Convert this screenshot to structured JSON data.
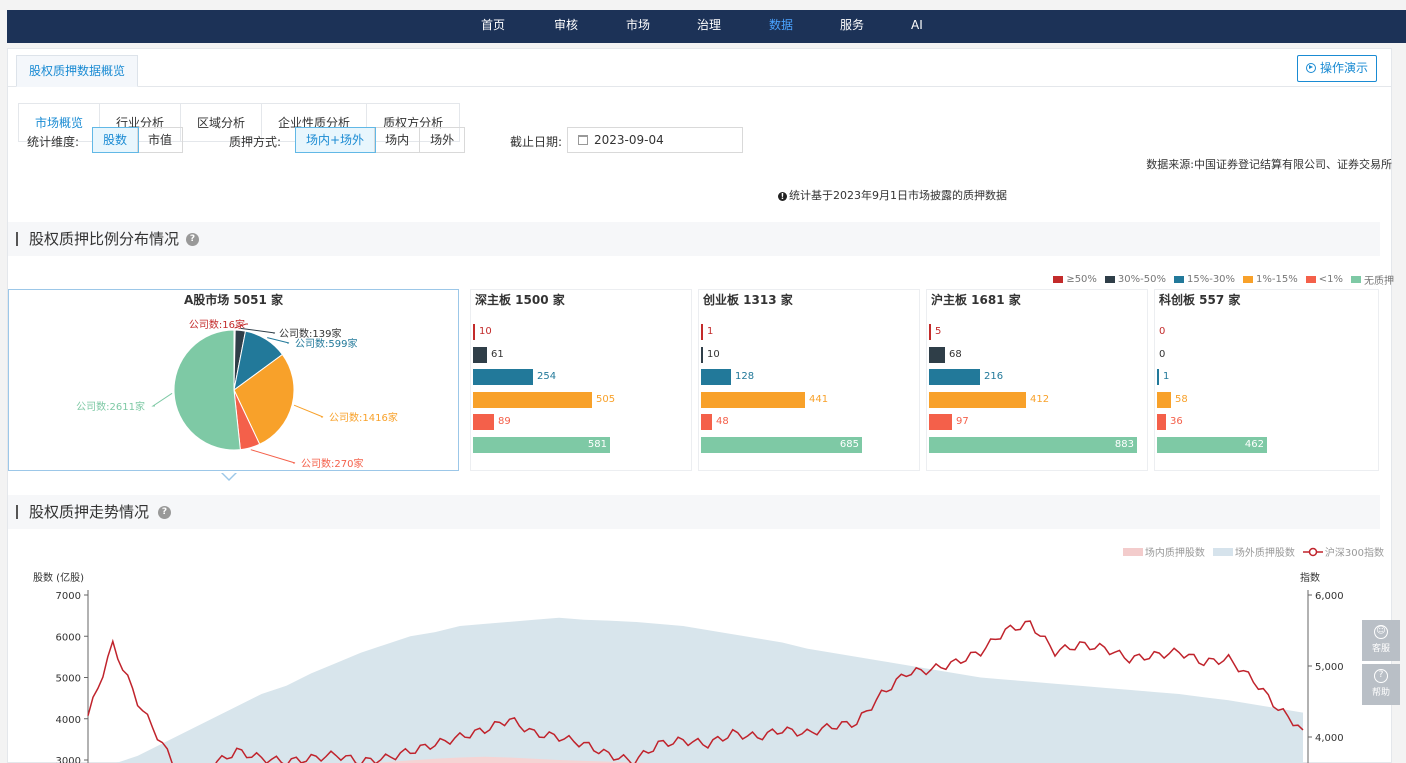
{
  "nav": {
    "items": [
      {
        "label": "首页",
        "active": false
      },
      {
        "label": "审核",
        "active": false
      },
      {
        "label": "市场",
        "active": false
      },
      {
        "label": "治理",
        "active": false
      },
      {
        "label": "数据",
        "active": true
      },
      {
        "label": "服务",
        "active": false
      },
      {
        "label": "AI",
        "active": false
      }
    ]
  },
  "page": {
    "main_tab": "股权质押数据概览",
    "demo_button": "操作演示",
    "subtabs": [
      "市场概览",
      "行业分析",
      "区域分析",
      "企业性质分析",
      "质权方分析"
    ],
    "active_subtab": "市场概览"
  },
  "filters": {
    "dimension_label": "统计维度:",
    "dimension_options": [
      "股数",
      "市值"
    ],
    "dimension_selected": "股数",
    "method_label": "质押方式:",
    "method_options": [
      "场内+场外",
      "场内",
      "场外"
    ],
    "method_selected": "场内+场外",
    "date_label": "截止日期:",
    "date_value": "2023-09-04",
    "note": "统计基于2023年9月1日市场披露的质押数据",
    "source": "数据来源:中国证券登记结算有限公司、证券交易所"
  },
  "section1": {
    "title": "股权质押比例分布情况"
  },
  "section2": {
    "title": "股权质押走势情况"
  },
  "colors": {
    "ge50": "#c32b2b",
    "p30_50": "#2f3e48",
    "p15_30": "#22799a",
    "p1_15": "#f8a12a",
    "lt1": "#f4604a",
    "none": "#7ec9a5",
    "nav_bg": "#1c3257",
    "accent": "#1a8bd3"
  },
  "chart_data": [
    {
      "type": "pie",
      "title": "A股市场 5051 家",
      "legend": [
        "≥50%",
        "30%-50%",
        "15%-30%",
        "1%-15%",
        "<1%",
        "无质押"
      ],
      "legend_position": "top-right",
      "labels": [
        "公司数:16家",
        "公司数:139家",
        "公司数:599家",
        "公司数:1416家",
        "公司数:270家",
        "公司数:2611家"
      ],
      "values": [
        16,
        139,
        599,
        1416,
        270,
        2611
      ]
    },
    {
      "type": "bar",
      "orientation": "horizontal",
      "boards": [
        {
          "title": "深主板 1500 家",
          "values": [
            10,
            61,
            254,
            505,
            89,
            581
          ]
        },
        {
          "title": "创业板 1313 家",
          "values": [
            1,
            10,
            128,
            441,
            48,
            685
          ]
        },
        {
          "title": "沪主板 1681 家",
          "values": [
            5,
            68,
            216,
            412,
            97,
            883
          ]
        },
        {
          "title": "科创板 557 家",
          "values": [
            0,
            0,
            1,
            58,
            36,
            462
          ]
        }
      ],
      "categories": [
        "≥50%",
        "30%-50%",
        "15%-30%",
        "1%-15%",
        "<1%",
        "无质押"
      ]
    },
    {
      "type": "area",
      "legend": [
        "场内质押股数",
        "场外质押股数",
        "沪深300指数"
      ],
      "legend_position": "top-right",
      "ylabel": "股数 (亿股)",
      "y2label": "指数",
      "y_ticks": [
        "7000",
        "6000",
        "5000",
        "4000",
        "3000"
      ],
      "y2_ticks": [
        "6,000",
        "5,000",
        "4,000"
      ],
      "ylim": [
        2800,
        7000
      ],
      "y2lim": [
        3700,
        6000
      ],
      "series": [
        {
          "name": "场外质押股数",
          "values": [
            2800,
            2900,
            3100,
            3400,
            3700,
            4000,
            4300,
            4600,
            4800,
            5100,
            5350,
            5600,
            5800,
            6000,
            6100,
            6250,
            6300,
            6350,
            6400,
            6450,
            6400,
            6380,
            6350,
            6300,
            6250,
            6150,
            6050,
            5950,
            5850,
            5700,
            5600,
            5500,
            5400,
            5300,
            5200,
            5100,
            5000,
            4950,
            4900,
            4850,
            4800,
            4750,
            4700,
            4650,
            4600,
            4520,
            4450,
            4350,
            4250,
            4150
          ]
        },
        {
          "name": "场内质押股数",
          "values": [
            2700,
            2720,
            2740,
            2760,
            2780,
            2800,
            2820,
            2840,
            2860,
            2880,
            2900,
            2920,
            2950,
            2990,
            3030,
            3060,
            3080,
            3060,
            3030,
            3000,
            2980,
            2960,
            2940,
            2920,
            2900,
            2880,
            2860,
            2840,
            2820,
            2800,
            2780,
            2760,
            2740,
            2720,
            2700,
            2680,
            2660,
            2640,
            2620,
            2600,
            2580,
            2560,
            2540,
            2520,
            2500,
            2480,
            2460,
            2440,
            2420,
            2400
          ]
        },
        {
          "name": "沪深300指数",
          "values": [
            4300,
            5300,
            4500,
            3900,
            3300,
            3600,
            3800,
            3700,
            3650,
            3700,
            3750,
            3650,
            3700,
            3800,
            3900,
            4000,
            4100,
            4250,
            4050,
            4000,
            3900,
            3750,
            3650,
            3900,
            3950,
            3900,
            4050,
            4000,
            4100,
            4050,
            4150,
            4200,
            4600,
            4900,
            4950,
            5050,
            5200,
            5500,
            5600,
            5200,
            5300,
            5250,
            5100,
            5150,
            5200,
            5050,
            5100,
            4800,
            4400,
            4100
          ]
        }
      ]
    }
  ]
}
